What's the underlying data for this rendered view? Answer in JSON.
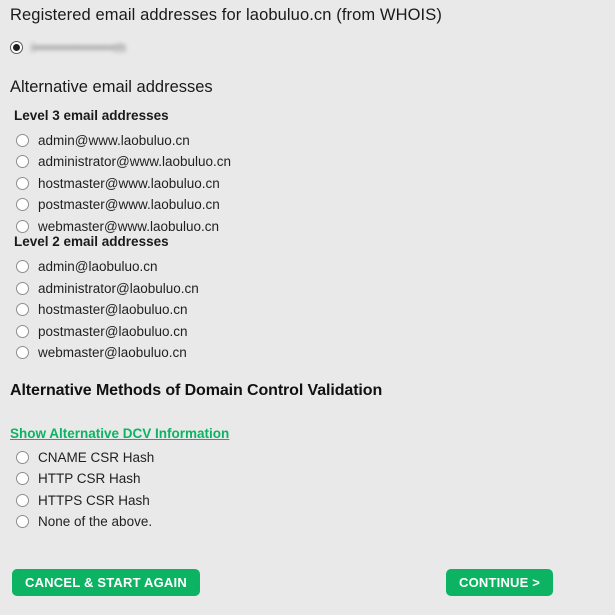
{
  "page": {
    "background_color": "#e9e9e9",
    "accent_color": "#0cb362"
  },
  "registered": {
    "title": "Registered email addresses for laobuluo.cn (from WHOIS)",
    "selected_email_redacted": "i•••••••••••••••m",
    "selected": true
  },
  "alternative": {
    "heading": "Alternative email addresses",
    "groups": [
      {
        "label": "Level 3 email addresses",
        "options": [
          "admin@www.laobuluo.cn",
          "administrator@www.laobuluo.cn",
          "hostmaster@www.laobuluo.cn",
          "postmaster@www.laobuluo.cn",
          "webmaster@www.laobuluo.cn"
        ]
      },
      {
        "label": "Level 2 email addresses",
        "options": [
          "admin@laobuluo.cn",
          "administrator@laobuluo.cn",
          "hostmaster@laobuluo.cn",
          "postmaster@laobuluo.cn",
          "webmaster@laobuluo.cn"
        ]
      }
    ]
  },
  "dcv": {
    "heading": "Alternative Methods of Domain Control Validation",
    "link_label": "Show Alternative DCV Information",
    "options": [
      "CNAME CSR Hash",
      "HTTP CSR Hash",
      "HTTPS CSR Hash",
      "None of the above."
    ]
  },
  "footer": {
    "cancel_label": "CANCEL & START AGAIN",
    "continue_label": "CONTINUE >"
  }
}
